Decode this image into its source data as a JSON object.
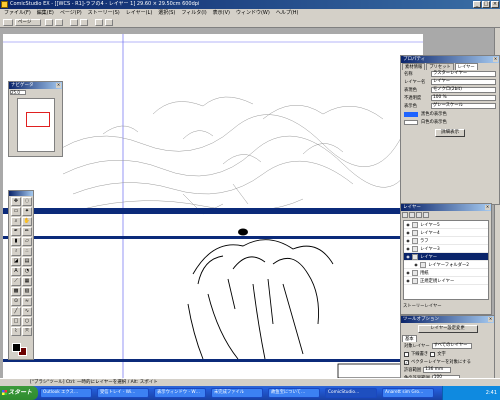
{
  "window": {
    "title": "ComicStudio EX - [[WCS - R1]-ラフの4 - レイヤー 1] 29.60 × 29.50cm 600dpi",
    "min": "_",
    "max": "□",
    "close": "×"
  },
  "menu": [
    "ファイル(F)",
    "編集(E)",
    "ページ(P)",
    "ストーリー(S)",
    "レイヤー(L)",
    "選択(S)",
    "フィルタ(I)",
    "表示(V)",
    "ウィンドウ(W)",
    "ヘルプ(H)"
  ],
  "toolstrip": {
    "page_label": "ページ"
  },
  "navigator": {
    "title": "ナビゲータ",
    "zoom": "25.0"
  },
  "properties": {
    "title": "プロパティ",
    "tabs": [
      "素材情報",
      "プリセット",
      "レイヤー"
    ],
    "rows": [
      {
        "label": "名称",
        "value": "ラスターレイヤー"
      },
      {
        "label": "レイヤー名",
        "value": "レイヤー"
      },
      {
        "label": "表現色",
        "value": "モノクロ(2bit)"
      },
      {
        "label": "不透明度",
        "value": "100 %"
      },
      {
        "label": "表示色",
        "value": "グレースケール"
      }
    ],
    "black_label": "黒色の表示色",
    "white_label": "白色の表示色",
    "show_button": "詳細表示"
  },
  "layers": {
    "title": "レイヤー",
    "items": [
      {
        "name": "レイヤー5",
        "selected": false,
        "indent": false
      },
      {
        "name": "レイヤー4",
        "selected": false,
        "indent": false
      },
      {
        "name": "ラフ",
        "selected": false,
        "indent": false
      },
      {
        "name": "レイヤー3",
        "selected": false,
        "indent": false
      },
      {
        "name": "レイヤー",
        "selected": true,
        "indent": false
      },
      {
        "name": "レイヤーフォルダー2",
        "selected": false,
        "indent": true
      },
      {
        "name": "用紙",
        "selected": false,
        "indent": false
      },
      {
        "name": "正規定規レイヤー",
        "selected": false,
        "indent": false
      }
    ],
    "footer": "ストーリーレイヤー"
  },
  "tool_options": {
    "title": "ツールオプション",
    "button": "レイヤー設定変更",
    "tab": "基本",
    "target_label": "対象レイヤー",
    "target_value": "すべてのレイヤー",
    "chk1": "下線書き",
    "chk2": "文字",
    "chk3": "ベクターレイヤーを対象にする",
    "tolerance_label": "許容範囲",
    "tolerance": "136 mm",
    "opacity_label": "色の許容範囲",
    "opacity": "100"
  },
  "status": "[\"ブラシ\"ツール] Ctrl: 一時的にレイヤーを選択 / Alt: スポイト",
  "taskbar": {
    "start": "スタート",
    "tasks": [
      "Outlook エクス…",
      "受信トレイ - Wi…",
      "表示ウィンドウ - W…",
      "未完成ファイル",
      "故鱼宝について…",
      "ComicStudio…",
      "Anarett sim Gro…"
    ],
    "clock": "2:41"
  }
}
